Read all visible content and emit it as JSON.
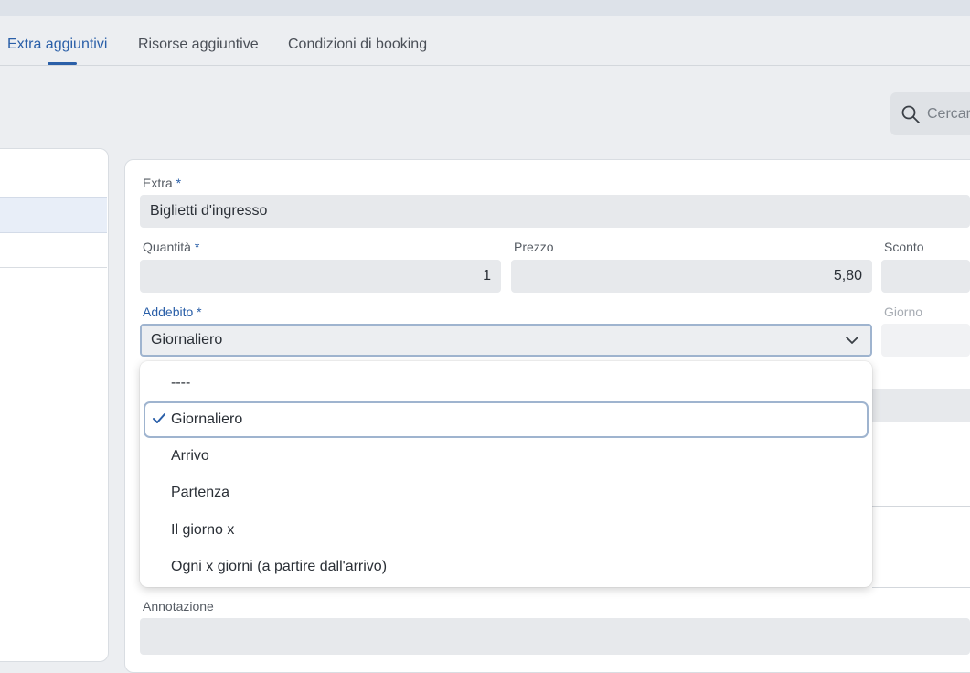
{
  "tabs": [
    {
      "label": "Extra aggiuntivi",
      "active": true
    },
    {
      "label": "Risorse aggiuntive",
      "active": false
    },
    {
      "label": "Condizioni di booking",
      "active": false
    }
  ],
  "search": {
    "placeholder": "Cercar"
  },
  "form": {
    "extra": {
      "label": "Extra",
      "required": "*",
      "value": "Biglietti d'ingresso"
    },
    "quantita": {
      "label": "Quantità",
      "required": "*",
      "value": "1"
    },
    "prezzo": {
      "label": "Prezzo",
      "value": "5,80"
    },
    "sconto": {
      "label": "Sconto",
      "value": ""
    },
    "addebito": {
      "label": "Addebito",
      "required": "*",
      "value": "Giornaliero"
    },
    "giorno": {
      "label": "Giorno",
      "value": ""
    },
    "annotazione": {
      "label": "Annotazione",
      "value": ""
    }
  },
  "dropdown": {
    "options": [
      "----",
      "Giornaliero",
      "Arrivo",
      "Partenza",
      "Il giorno x",
      "Ogni x giorni (a partire dall'arrivo)"
    ],
    "selected": "Giornaliero"
  },
  "colors": {
    "accent": "#2a5fa8",
    "background": "#eceef1",
    "field": "#e7e9ec"
  },
  "icons": {
    "search": "search-icon",
    "chevron": "chevron-down-icon",
    "check": "check-icon"
  }
}
